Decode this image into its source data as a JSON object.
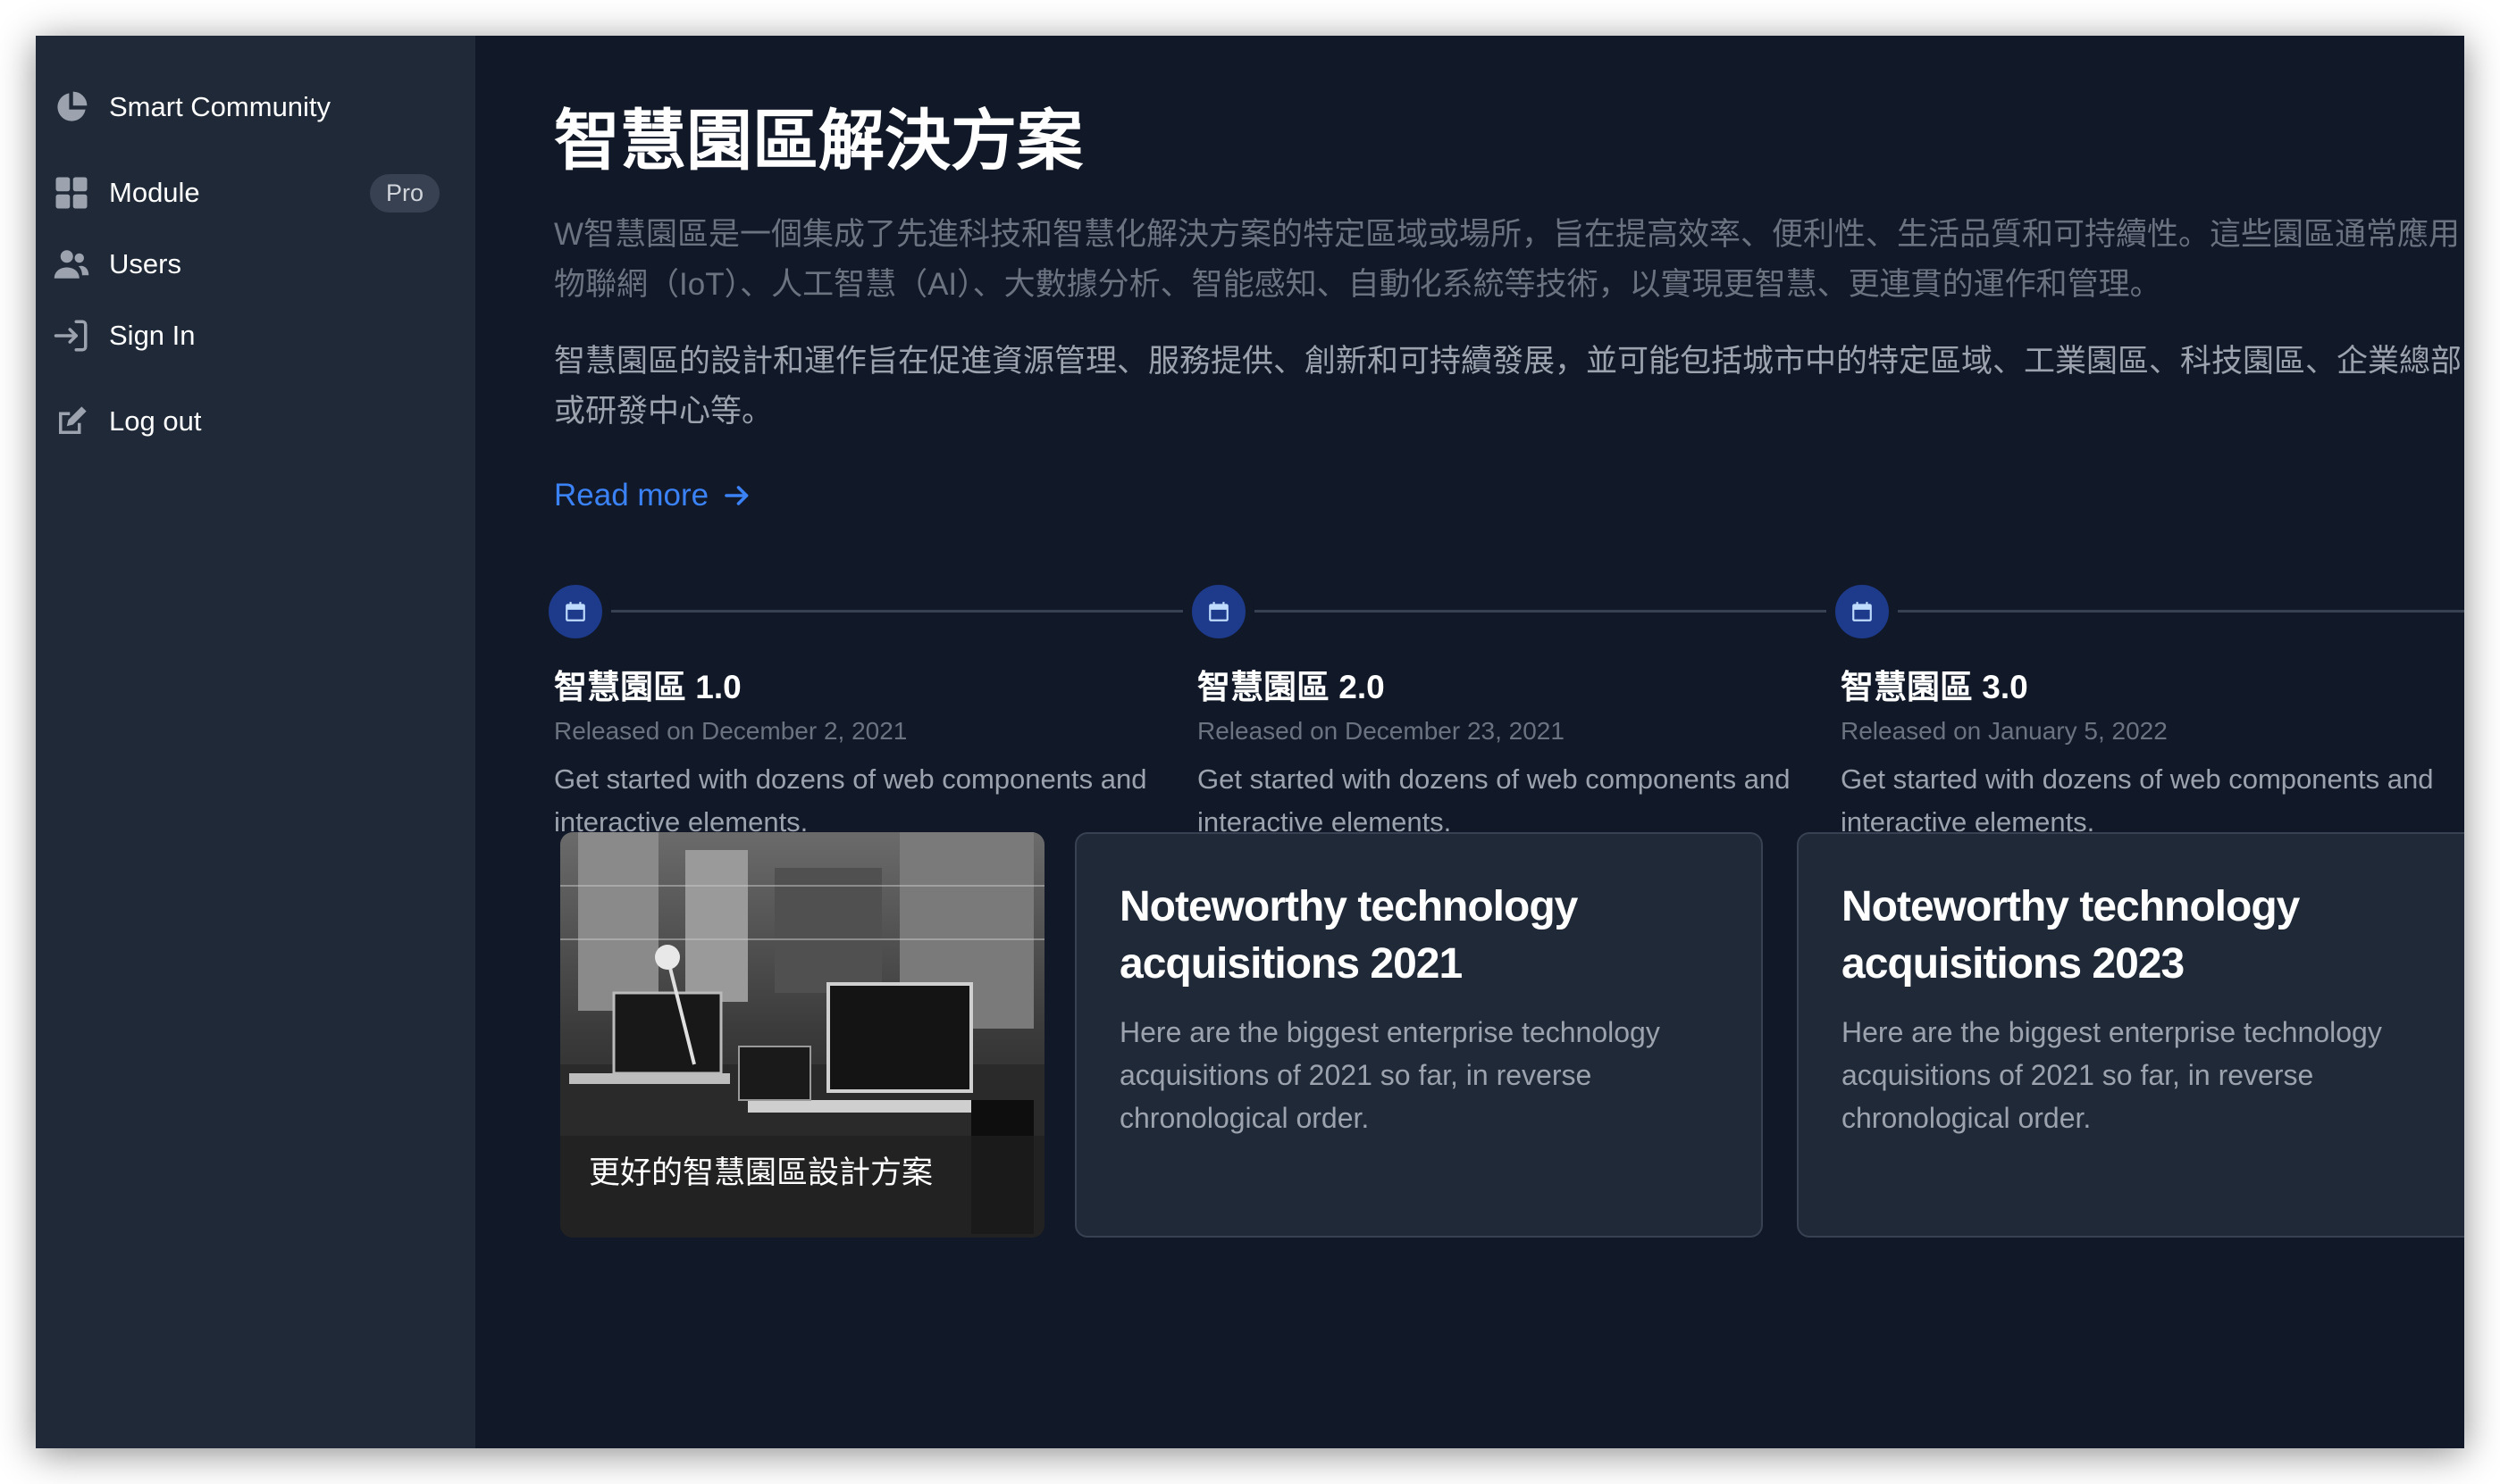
{
  "sidebar": {
    "items": [
      {
        "label": "Smart Community",
        "icon": "pie-chart-icon"
      },
      {
        "label": "Module",
        "icon": "grid-icon",
        "badge": "Pro"
      },
      {
        "label": "Users",
        "icon": "users-icon"
      },
      {
        "label": "Sign In",
        "icon": "sign-in-icon"
      },
      {
        "label": "Log out",
        "icon": "edit-icon"
      }
    ]
  },
  "main": {
    "title": "智慧園區解決方案",
    "intro1": "W智慧園區是一個集成了先進科技和智慧化解決方案的特定區域或場所，旨在提高效率、便利性、生活品質和可持續性。這些園區通常應用物聯網（IoT）、人工智慧（AI）、大數據分析、智能感知、自動化系統等技術，以實現更智慧、更連貫的運作和管理。",
    "intro2": "智慧園區的設計和運作旨在促進資源管理、服務提供、創新和可持續發展，並可能包括城市中的特定區域、工業園區、科技園區、企業總部或研發中心等。",
    "read_more": "Read more"
  },
  "timeline": [
    {
      "title": "智慧園區 1.0",
      "date": "Released on December 2, 2021",
      "desc": "Get started with dozens of web components and interactive elements."
    },
    {
      "title": "智慧園區 2.0",
      "date": "Released on December 23, 2021",
      "desc": "Get started with dozens of web components and interactive elements."
    },
    {
      "title": "智慧園區 3.0",
      "date": "Released on January 5, 2022",
      "desc": "Get started with dozens of web components and interactive elements."
    }
  ],
  "cards": {
    "photo_caption": "更好的智慧園區設計方案",
    "items": [
      {
        "title": "Noteworthy technology acquisitions 2021",
        "desc": "Here are the biggest enterprise technology acquisitions of 2021 so far, in reverse chronological order."
      },
      {
        "title": "Noteworthy technology acquisitions 2023",
        "desc": "Here are the biggest enterprise technology acquisitions of 2021 so far, in reverse chronological order."
      }
    ]
  },
  "colors": {
    "background": "#111827",
    "sidebar": "#1f2937",
    "accent": "#3b82f6",
    "timeline_dot": "#1e3a8a"
  }
}
